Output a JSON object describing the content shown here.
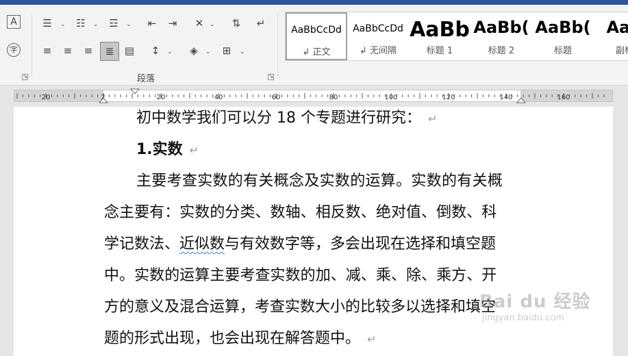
{
  "ribbon": {
    "group_label": "段落"
  },
  "styles": [
    {
      "sample": "AaBbCcDd",
      "name": "↲ 正文",
      "size": "14px",
      "weight": "normal"
    },
    {
      "sample": "AaBbCcDd",
      "name": "↲ 无间隔",
      "size": "14px",
      "weight": "normal"
    },
    {
      "sample": "AaBb",
      "name": "标题 1",
      "size": "30px",
      "weight": "bold"
    },
    {
      "sample": "AaBb(",
      "name": "标题 2",
      "size": "24px",
      "weight": "bold"
    },
    {
      "sample": "AaBb(",
      "name": "标题",
      "size": "24px",
      "weight": "bold"
    },
    {
      "sample": "AaB",
      "name": "副标",
      "size": "24px",
      "weight": "bold"
    }
  ],
  "ruler": {
    "labels": [
      "20",
      "2",
      "20",
      "40",
      "60",
      "80",
      "100",
      "120",
      "140",
      "160"
    ]
  },
  "document": {
    "line1": "初中数学我们可以分 18 个专题进行研究：",
    "heading": "1.实数",
    "p1": "主要考查实数的有关概念及实数的运算。实数的有关概",
    "p2": "念主要有：实数的分类、数轴、相反数、绝对值、倒数、科",
    "p3_a": "学记数法、",
    "p3_b": "近似数",
    "p3_c": "与有效数字等，多会出现在选择和填空题",
    "p4": "中。实数的运算主要考查实数的加、减、乘、除、乘方、开",
    "p5": "方的意义及混合运算，考查实数大小的比较多以选择和填空",
    "p6": "题的形式出现，也会出现在解答题中。",
    "para_mark": "↵"
  },
  "watermark": {
    "brand": "Bai du 经验",
    "url": "jingyan.baidu.com"
  }
}
